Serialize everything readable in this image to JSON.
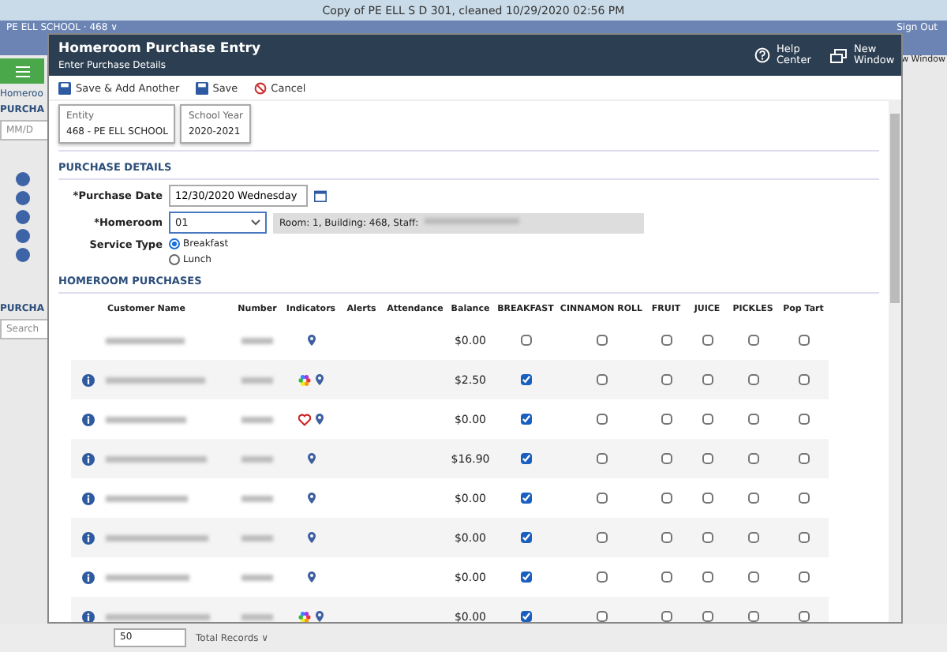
{
  "top_bar": {
    "title": "Copy of PE ELL S D 301, cleaned 10/29/2020 02:56 PM"
  },
  "app_header": {
    "school": "PE ELL SCHOOL · 468 ∨",
    "sign_out": "Sign Out",
    "new_window": "w Window"
  },
  "background": {
    "link": "Homeroo",
    "section_1": "PURCHA",
    "date_placeholder": "MM/D",
    "section_2": "PURCHA",
    "search_placeholder": "Search",
    "page_size": "50",
    "total_records": "Total Records ∨"
  },
  "modal": {
    "title": "Homeroom Purchase Entry",
    "subtitle": "Enter Purchase Details",
    "help": "Help Center",
    "new_window": "New Window",
    "toolbar": [
      "Save & Add Another",
      "Save",
      "Cancel"
    ],
    "context": [
      {
        "label": "Entity",
        "value": "468 - PE ELL SCHOOL"
      },
      {
        "label": "School Year",
        "value": "2020-2021"
      }
    ],
    "details_heading": "PURCHASE DETAILS",
    "purchase_date": {
      "label": "*Purchase Date",
      "value": "12/30/2020 Wednesday"
    },
    "homeroom": {
      "label": "*Homeroom",
      "value": "01",
      "info": "Room: 1, Building: 468, Staff:"
    },
    "service_type": {
      "label": "Service Type",
      "options": [
        {
          "label": "Breakfast",
          "selected": true
        },
        {
          "label": "Lunch",
          "selected": false
        }
      ]
    },
    "purchases_heading": "HOMEROOM PURCHASES",
    "columns": [
      "Customer Name",
      "Number",
      "Indicators",
      "Alerts",
      "Attendance",
      "Balance",
      "BREAKFAST",
      "CINNAMON ROLL",
      "FRUIT",
      "JUICE",
      "PICKLES",
      "Pop Tart"
    ],
    "rows": [
      {
        "info": false,
        "indicators": [
          {
            "kind": "pin"
          }
        ],
        "balance": "$0.00",
        "items": [
          false,
          false,
          false,
          false,
          false,
          false
        ]
      },
      {
        "info": true,
        "indicators": [
          {
            "kind": "flower"
          },
          {
            "kind": "pin"
          }
        ],
        "balance": "$2.50",
        "items": [
          true,
          false,
          false,
          false,
          false,
          false
        ]
      },
      {
        "info": true,
        "indicators": [
          {
            "kind": "heart"
          },
          {
            "kind": "pin"
          }
        ],
        "balance": "$0.00",
        "items": [
          true,
          false,
          false,
          false,
          false,
          false
        ]
      },
      {
        "info": true,
        "indicators": [
          {
            "kind": "pin"
          }
        ],
        "balance": "$16.90",
        "items": [
          true,
          false,
          false,
          false,
          false,
          false
        ]
      },
      {
        "info": true,
        "indicators": [
          {
            "kind": "pin"
          }
        ],
        "balance": "$0.00",
        "items": [
          true,
          false,
          false,
          false,
          false,
          false
        ]
      },
      {
        "info": true,
        "indicators": [
          {
            "kind": "pin"
          }
        ],
        "balance": "$0.00",
        "items": [
          true,
          false,
          false,
          false,
          false,
          false
        ]
      },
      {
        "info": true,
        "indicators": [
          {
            "kind": "pin"
          }
        ],
        "balance": "$0.00",
        "items": [
          true,
          false,
          false,
          false,
          false,
          false
        ]
      },
      {
        "info": true,
        "indicators": [
          {
            "kind": "flower"
          },
          {
            "kind": "pin"
          }
        ],
        "balance": "$0.00",
        "items": [
          true,
          false,
          false,
          false,
          false,
          false
        ]
      }
    ]
  }
}
